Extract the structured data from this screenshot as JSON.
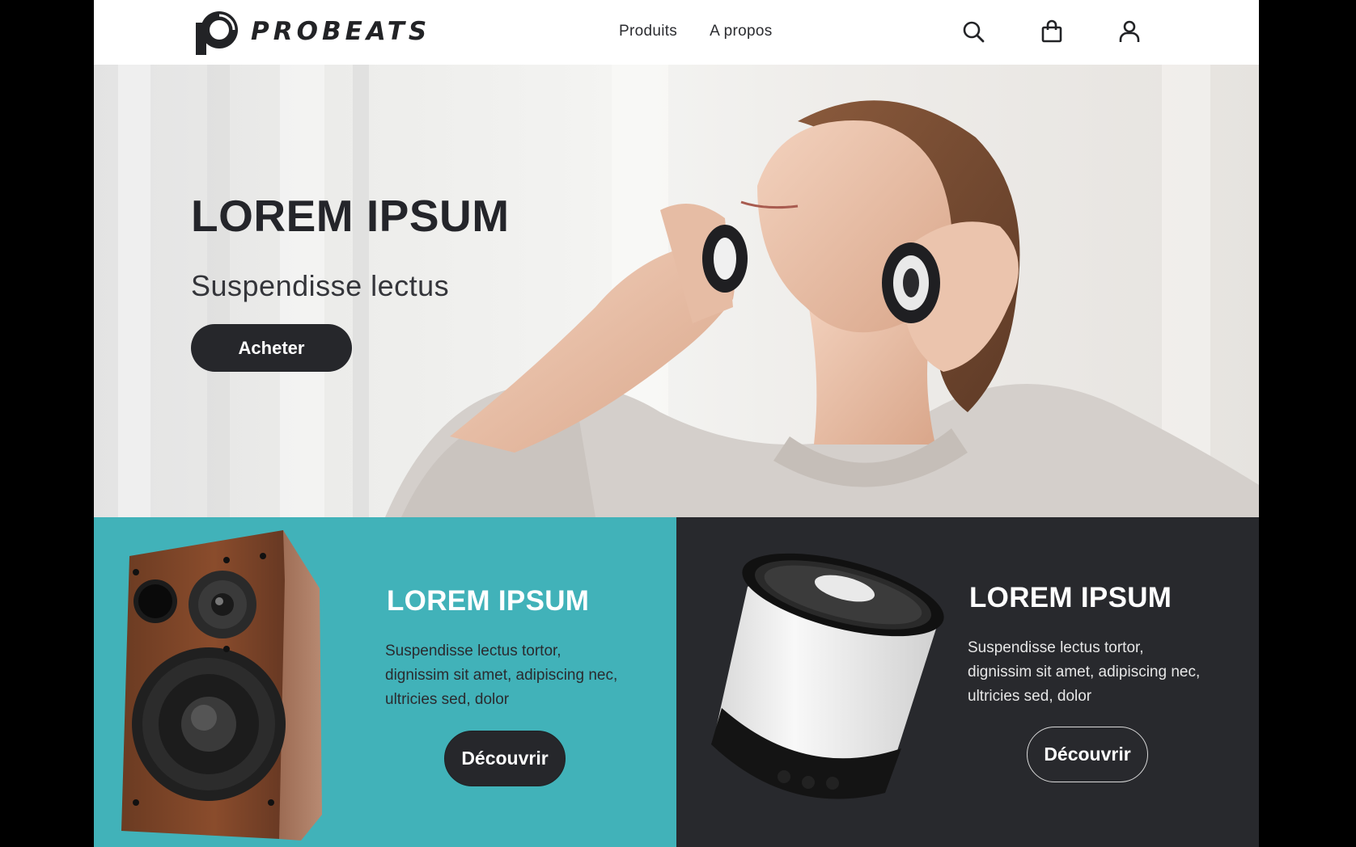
{
  "brand": {
    "name": "PROBEATS",
    "logo": "probeats-logo-mark"
  },
  "nav": {
    "items": [
      {
        "label": "Produits"
      },
      {
        "label": "A propos"
      }
    ]
  },
  "header_icons": [
    "search-icon",
    "shopping-bag-icon",
    "user-icon"
  ],
  "hero": {
    "title": "LOREM IPSUM",
    "subtitle": "Suspendisse lectus",
    "button_label": "Acheter",
    "image": "woman-wearing-headphones-photo"
  },
  "cards": [
    {
      "title": "LOREM IPSUM",
      "text": "Suspendisse lectus tortor, dignissim sit amet, adipiscing nec, ultricies sed, dolor",
      "button_label": "Découvrir",
      "image": "wooden-bookshelf-speaker",
      "background": "#41b2b9"
    },
    {
      "title": "LOREM IPSUM",
      "text": "Suspendisse lectus tortor, dignissim sit amet, adipiscing nec, ultricies sed, dolor",
      "button_label": "Découvrir",
      "image": "white-cylinder-bluetooth-speaker",
      "background": "#28292d"
    }
  ],
  "colors": {
    "accent_dark": "#26272b",
    "teal": "#41b2b9",
    "dark_panel": "#28292d",
    "text_dark": "#24252a"
  }
}
